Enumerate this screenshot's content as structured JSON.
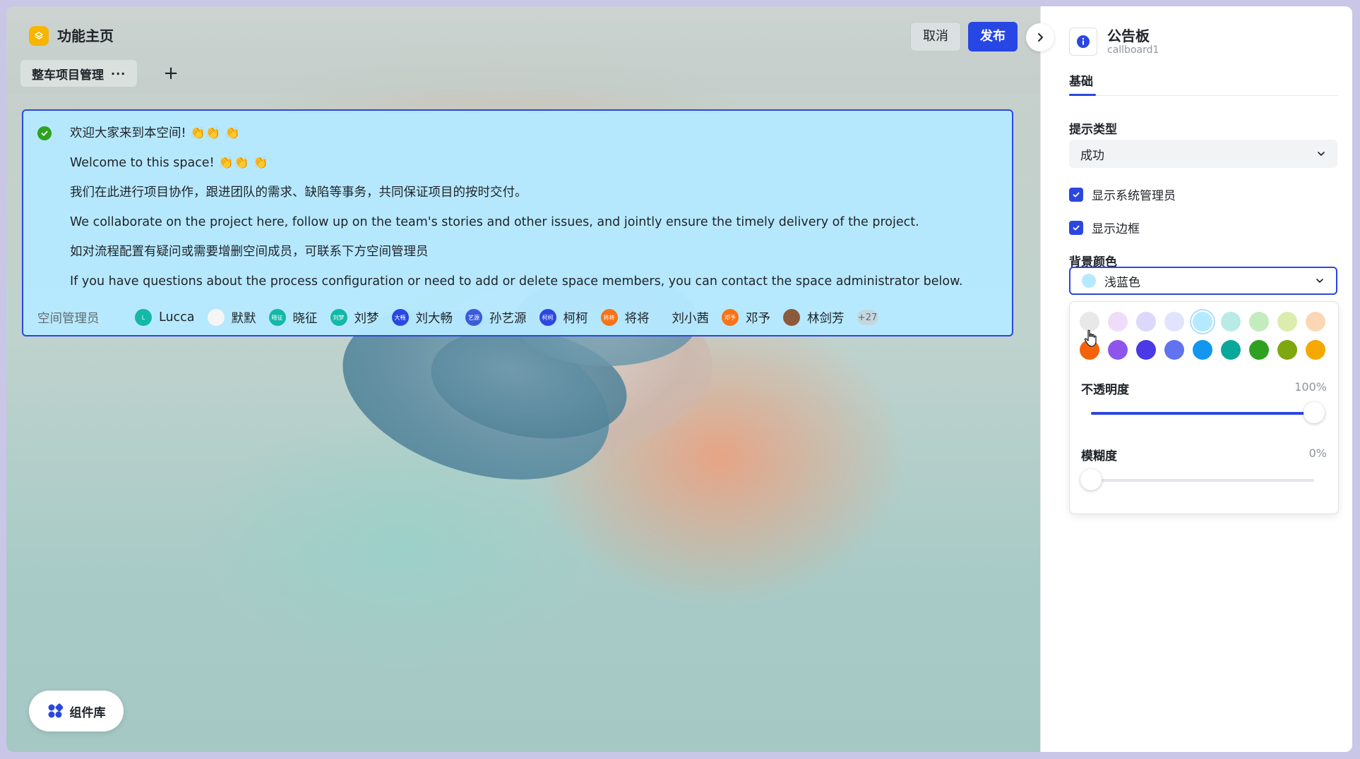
{
  "app": {
    "title": "功能主页",
    "tab": "整车项目管理",
    "tab_more": "···",
    "add_tab": "+"
  },
  "toolbar": {
    "cancel_label": "取消",
    "publish_label": "发布"
  },
  "callboard": {
    "lines": [
      "欢迎大家来到本空间! 👏👏 👏",
      "Welcome to this space! 👏👏 👏",
      "我们在此进行项目协作，跟进团队的需求、缺陷等事务，共同保证项目的按时交付。",
      "We collaborate on the project here, follow up on the team's stories and other issues, and jointly ensure the timely delivery of the project.",
      "如对流程配置有疑问或需要增删空间成员，可联系下方空间管理员",
      "If you have questions about the process configuration or need to add or delete space members, you can contact the space administrator below."
    ],
    "admins_label": "空间管理员",
    "members": [
      {
        "name": "Lucca",
        "avatar_text": "L",
        "color": "#14b8a6"
      },
      {
        "name": "默默",
        "avatar_text": "",
        "color": "#f5f5f5"
      },
      {
        "name": "晓征",
        "avatar_text": "晓征",
        "color": "#14b8a6"
      },
      {
        "name": "刘梦",
        "avatar_text": "刘梦",
        "color": "#14b8a6"
      },
      {
        "name": "刘大畅",
        "avatar_text": "大畅",
        "color": "#2b47e0"
      },
      {
        "name": "孙艺源",
        "avatar_text": "艺源",
        "color": "#3b5bdb"
      },
      {
        "name": "柯柯",
        "avatar_text": "柯柯",
        "color": "#2b47e0"
      },
      {
        "name": "将将",
        "avatar_text": "将将",
        "color": "#f97316"
      },
      {
        "name": "刘小茜",
        "avatar_text": "",
        "color": "transparent"
      },
      {
        "name": "邓予",
        "avatar_text": "邓予",
        "color": "#f97316"
      },
      {
        "name": "林剑芳",
        "avatar_text": "",
        "color": "#8b5a3c"
      }
    ],
    "more_count": "+27"
  },
  "component_library": {
    "label": "组件库"
  },
  "panel": {
    "title": "公告板",
    "subtitle": "callboard1",
    "tab": "基础",
    "tip_type_label": "提示类型",
    "tip_type_value": "成功",
    "show_admin_label": "显示系统管理员",
    "show_border_label": "显示边框",
    "bg_color_label": "背景颜色",
    "bg_color_value": "浅蓝色",
    "bg_color_swatch": "#b5e9ff",
    "swatches_row1": [
      "#e8e8e8",
      "#eedcfa",
      "#dcd8fb",
      "#e2e3fc",
      "#b5e9ff",
      "#b8ebe6",
      "#c3ecbe",
      "#dcecaf",
      "#fbd7b5"
    ],
    "swatches_row2": [
      "#f4630c",
      "#8e55ec",
      "#4b38e6",
      "#6273f0",
      "#1296f0",
      "#0aa89a",
      "#2ea121",
      "#7fa70f",
      "#f5a800"
    ],
    "selected_swatch": 4,
    "opacity_label": "不透明度",
    "opacity_value": "100%",
    "opacity": 1.0,
    "blur_label": "模糊度",
    "blur_value": "0%",
    "blur": 0.0
  }
}
